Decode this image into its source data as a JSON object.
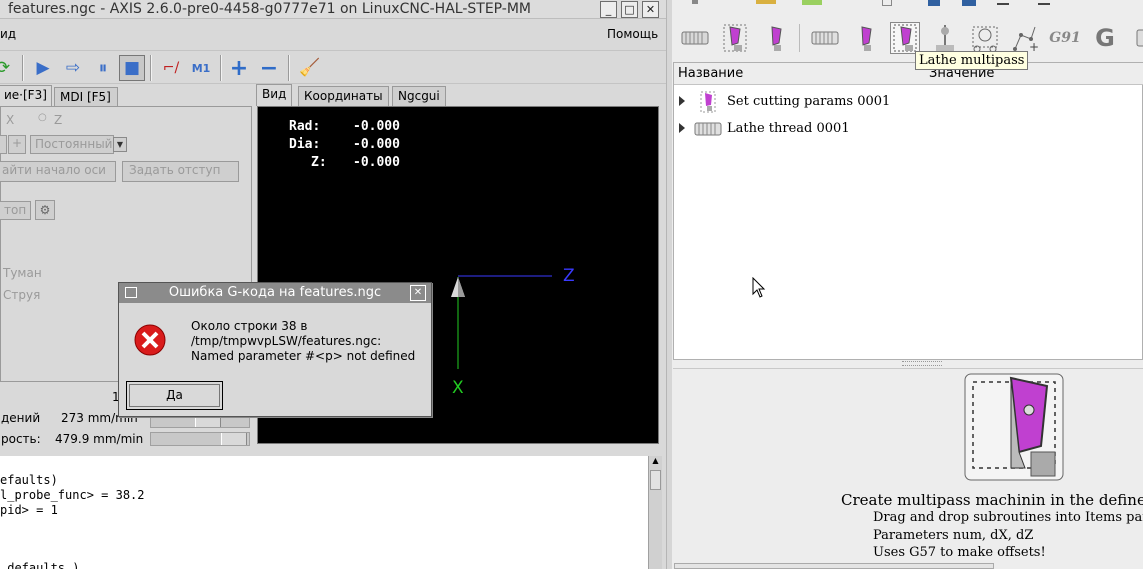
{
  "axis": {
    "title": "features.ngc - AXIS 2.6.0-pre0-4458-g0777e71 on LinuxCNC-HAL-STEP-MM",
    "win_min": "_",
    "win_max": "□",
    "win_close": "✕",
    "menu": {
      "view": "ид",
      "help": "Помощь"
    },
    "tabs": {
      "manual": "ие·[F3]",
      "mdi": "MDI [F5]"
    },
    "manual": {
      "axis_x": "X",
      "axis_z": "Z",
      "mode": "Постоянный",
      "plus": "+",
      "home_btn": "айти начало оси",
      "offset_btn": "Задать отступ",
      "stop": "топ",
      "mist": "Туман",
      "flood": "Струя"
    },
    "feed": {
      "number_partial": "1",
      "label1": "дений",
      "value1": "273 mm/min",
      "label2": "рость:",
      "value2": "479.9 mm/min"
    },
    "view_tabs": {
      "view": "Вид",
      "coords": "Координаты",
      "ngcgui": "Ngcgui"
    },
    "dro": {
      "rad_label": "Rad:",
      "rad": "-0.000",
      "dia_label": "Dia:",
      "dia": "-0.000",
      "z_label": "Z:",
      "z": "-0.000"
    },
    "axes": {
      "z": "Z",
      "x": "X"
    },
    "gcode_lines": [
      "efaults)",
      "l_probe_func> = 38.2",
      "pid> = 1",
      "",
      "",
      "_defaults )"
    ]
  },
  "error_dialog": {
    "title": "Ошибка G-кода на features.ngc",
    "close": "✕",
    "message": "Около строки 38 в\n/tmp/tmpwvpLSW/features.ngc:\nNamed parameter #<p> not defined",
    "ok": "Да"
  },
  "features": {
    "tooltip": "Lathe multipass",
    "g91_label": "G91",
    "columns": {
      "name": "Название",
      "value": "Значение"
    },
    "items": [
      {
        "label": "Set cutting params 0001"
      },
      {
        "label": "Lathe thread 0001"
      }
    ],
    "desc": {
      "title": "Create multipass machinin in the defined dir",
      "lines": [
        "Drag and drop subroutines into Items paramet",
        "Parameters num, dX, dZ",
        "Uses G57 to make offsets!"
      ]
    }
  },
  "colors": {
    "accent_purple": "#c040d0",
    "preview_bg": "#000000",
    "z_axis": "#3a3aff",
    "x_axis": "#22cc22",
    "error_red": "#d91c1c",
    "tooltip_bg": "#ffffe1"
  }
}
